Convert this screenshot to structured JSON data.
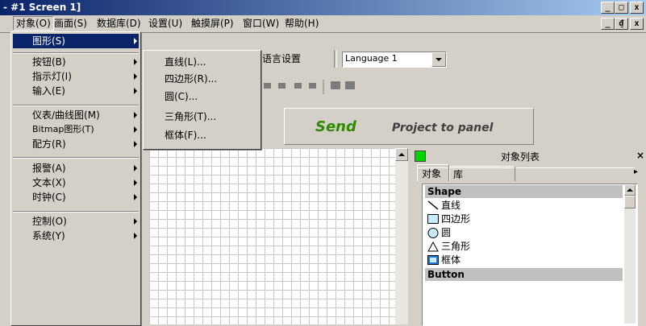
{
  "window": {
    "title": "- #1 Screen 1]",
    "min": "_",
    "max": "□",
    "close": "x",
    "restore": "₫"
  },
  "menubar": [
    {
      "label": "对象(O)"
    },
    {
      "label": "画面(S)"
    },
    {
      "label": "数据库(D)"
    },
    {
      "label": "设置(U)"
    },
    {
      "label": "触摸屏(P)"
    },
    {
      "label": "窗口(W)"
    },
    {
      "label": "帮助(H)"
    }
  ],
  "toolbar": {
    "language_settings": "语言设置",
    "language_select": "Language 1",
    "send_bold": "Send",
    "send_rest": "Project to panel"
  },
  "object_menu": {
    "items": [
      {
        "label": "图形(S)",
        "submenu": true
      },
      {
        "label": "按钮(B)",
        "submenu": true
      },
      {
        "label": "指示灯(I)",
        "submenu": true
      },
      {
        "label": "输入(E)",
        "submenu": true
      },
      {
        "label": "仪表/曲线图(M)",
        "submenu": true
      },
      {
        "label": "Bitmap图形(T)",
        "submenu": true
      },
      {
        "label": "配方(R)",
        "submenu": true
      },
      {
        "label": "报警(A)",
        "submenu": true
      },
      {
        "label": "文本(X)",
        "submenu": true
      },
      {
        "label": "时钟(C)",
        "submenu": true
      },
      {
        "label": "控制(O)",
        "submenu": true
      },
      {
        "label": "系统(Y)",
        "submenu": true
      }
    ]
  },
  "shape_submenu": {
    "items": [
      {
        "label": "直线(L)..."
      },
      {
        "label": "四边形(R)..."
      },
      {
        "label": "圆(C)..."
      },
      {
        "label": "三角形(T)..."
      },
      {
        "label": "框体(F)..."
      }
    ]
  },
  "object_list": {
    "title": "对象列表",
    "close": "×",
    "tabs": [
      {
        "label": "对象"
      },
      {
        "label": "库"
      }
    ],
    "tab_arrow": "▸",
    "rows": [
      {
        "label": "Shape",
        "header": true
      },
      {
        "label": "直线",
        "icon": "line-icon"
      },
      {
        "label": "四边形",
        "icon": "rectangle-icon"
      },
      {
        "label": "圆",
        "icon": "circle-icon"
      },
      {
        "label": "三角形",
        "icon": "triangle-icon"
      },
      {
        "label": "框体",
        "icon": "frame-icon"
      },
      {
        "label": "Button",
        "header": true
      }
    ]
  },
  "colors": {
    "title_bar": "#0a246a",
    "selection": "#0a246a",
    "send_green": "#2e8b00",
    "indicator_green": "#00d400"
  }
}
